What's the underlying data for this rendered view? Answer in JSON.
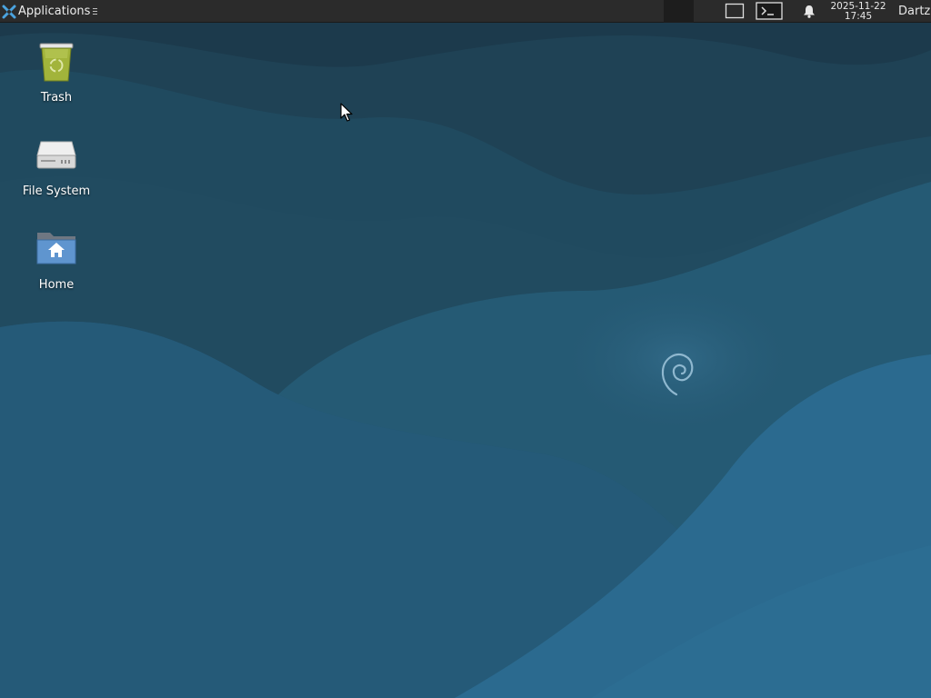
{
  "panel": {
    "applications_label": "Applications",
    "clock_date": "2025-11-22",
    "clock_time": "17:45",
    "user_label": "Dartz"
  },
  "desktop_icons": [
    {
      "label": "Trash",
      "icon": "trash-icon"
    },
    {
      "label": "File System",
      "icon": "drive-icon"
    },
    {
      "label": "Home",
      "icon": "home-folder-icon"
    }
  ],
  "colors": {
    "panel_bg": "#2b2b2b",
    "wallpaper_dark": "#1d3a4c",
    "wallpaper_mid": "#24526b",
    "wallpaper_light": "#2c6a8c",
    "trash_green": "#a2b43b",
    "folder_blue": "#5f95cf"
  }
}
